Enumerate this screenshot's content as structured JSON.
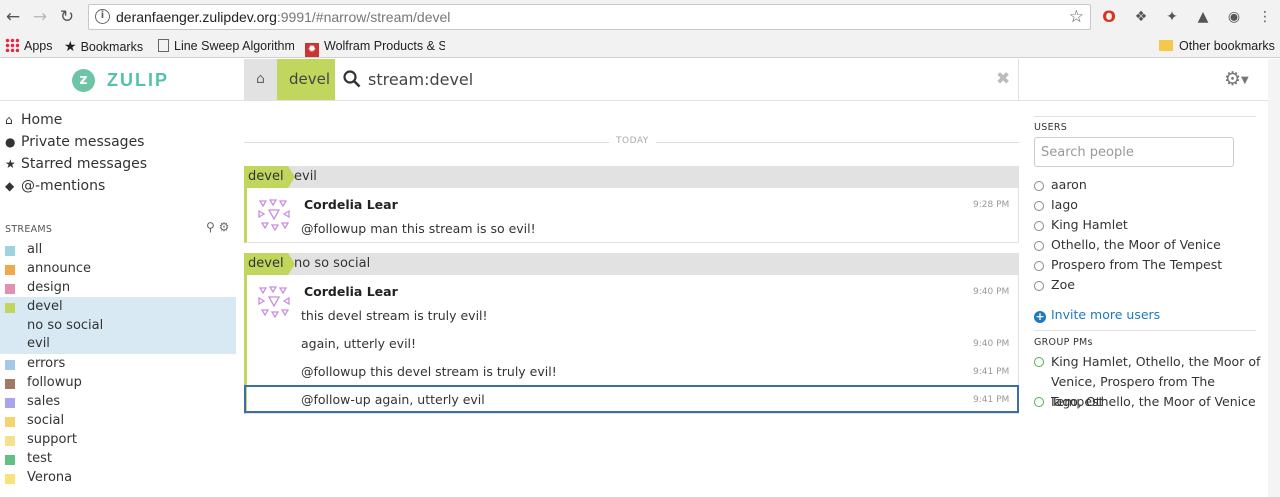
{
  "browser": {
    "url_host": "deranfaenger.zulipdev.org",
    "url_rest": ":9991/#narrow/stream/devel",
    "bookmarks": [
      "Apps",
      "Bookmarks",
      "Line Sweep Algorithm",
      "Wolfram Products & S",
      "Other bookmarks"
    ]
  },
  "header": {
    "brand": "ZULIP",
    "stream_tab": "devel",
    "search_value": "stream:devel"
  },
  "left_nav": {
    "items": [
      "Home",
      "Private messages",
      "Starred messages",
      "@-mentions"
    ],
    "streams_label": "STREAMS",
    "streams": [
      {
        "name": "all",
        "color": "#9fd3df"
      },
      {
        "name": "announce",
        "color": "#f0a74e"
      },
      {
        "name": "design",
        "color": "#e090b0"
      },
      {
        "name": "devel",
        "color": "#c1d65c"
      },
      {
        "name": "errors",
        "color": "#a6c7e5"
      },
      {
        "name": "followup",
        "color": "#a07a64"
      },
      {
        "name": "sales",
        "color": "#a9a4f0"
      },
      {
        "name": "social",
        "color": "#f5d46a"
      },
      {
        "name": "support",
        "color": "#f8e08a"
      },
      {
        "name": "test",
        "color": "#5fc185"
      },
      {
        "name": "Verona",
        "color": "#f7e27b"
      }
    ],
    "devel_topics": [
      "no so social",
      "evil"
    ]
  },
  "messages": {
    "date_label": "TODAY",
    "groups": [
      {
        "stream": "devel",
        "topic": "evil",
        "sender": "Cordelia Lear",
        "rows": [
          {
            "text": "@followup man this stream is so evil!",
            "time": "9:28 PM"
          }
        ]
      },
      {
        "stream": "devel",
        "topic": "no so social",
        "sender": "Cordelia Lear",
        "rows": [
          {
            "text": "this devel stream is truly evil!",
            "time": "9:40 PM"
          },
          {
            "text": "again, utterly evil!",
            "time": "9:40 PM"
          },
          {
            "text": "@followup this devel stream is truly evil!",
            "time": "9:41 PM"
          },
          {
            "text": "@follow-up again, utterly evil",
            "time": "9:41 PM"
          }
        ]
      }
    ]
  },
  "right_sidebar": {
    "users_label": "USERS",
    "search_placeholder": "Search people",
    "users": [
      "aaron",
      "Iago",
      "King Hamlet",
      "Othello, the Moor of Venice",
      "Prospero from The Tempest",
      "Zoe"
    ],
    "invite_label": "Invite more users",
    "group_pms_label": "GROUP PMs",
    "group_pms": [
      "King Hamlet, Othello, the Moor of Venice, Prospero from The Tempest",
      "Iago, Othello, the Moor of Venice"
    ]
  }
}
